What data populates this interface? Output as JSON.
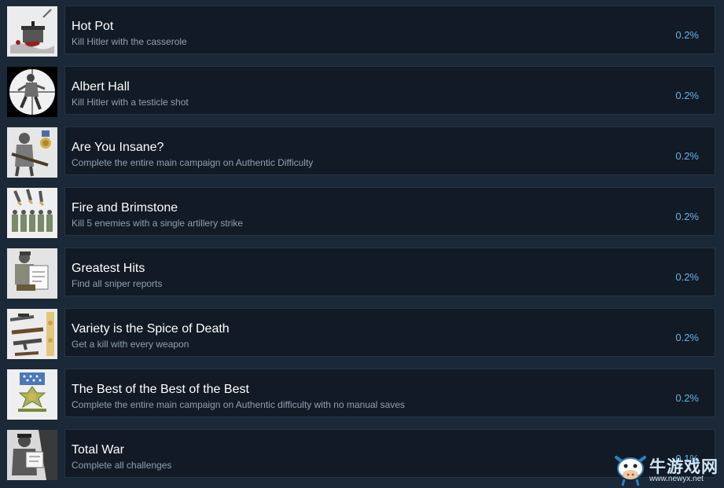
{
  "achievements": [
    {
      "title": "Hot Pot",
      "description": "Kill Hitler with the casserole",
      "percent": "0.2%",
      "icon": "casserole-icon"
    },
    {
      "title": "Albert Hall",
      "description": "Kill Hitler with a testicle shot",
      "percent": "0.2%",
      "icon": "scope-target-icon"
    },
    {
      "title": "Are You Insane?",
      "description": "Complete the entire main campaign on Authentic Difficulty",
      "percent": "0.2%",
      "icon": "soldier-medal-icon"
    },
    {
      "title": "Fire and Brimstone",
      "description": "Kill 5 enemies with a single artillery strike",
      "percent": "0.2%",
      "icon": "artillery-icon"
    },
    {
      "title": "Greatest Hits",
      "description": "Find all sniper reports",
      "percent": "0.2%",
      "icon": "sniper-report-icon"
    },
    {
      "title": "Variety is the Spice of Death",
      "description": "Get a kill with every weapon",
      "percent": "0.2%",
      "icon": "weapons-icon"
    },
    {
      "title": "The Best of the Best of the Best",
      "description": "Complete the entire main campaign on Authentic difficulty with no manual saves",
      "percent": "0.2%",
      "icon": "medal-of-honor-icon"
    },
    {
      "title": "Total War",
      "description": "Complete all challenges",
      "percent": "0.1%",
      "icon": "officer-map-icon"
    }
  ],
  "watermark": {
    "text": "牛游戏网",
    "url": "www.newyx.net"
  },
  "colors": {
    "background": "#1b2838",
    "panel": "#121a25",
    "title": "#ffffff",
    "description": "#8fa0b0",
    "percent": "#67b2e5"
  }
}
